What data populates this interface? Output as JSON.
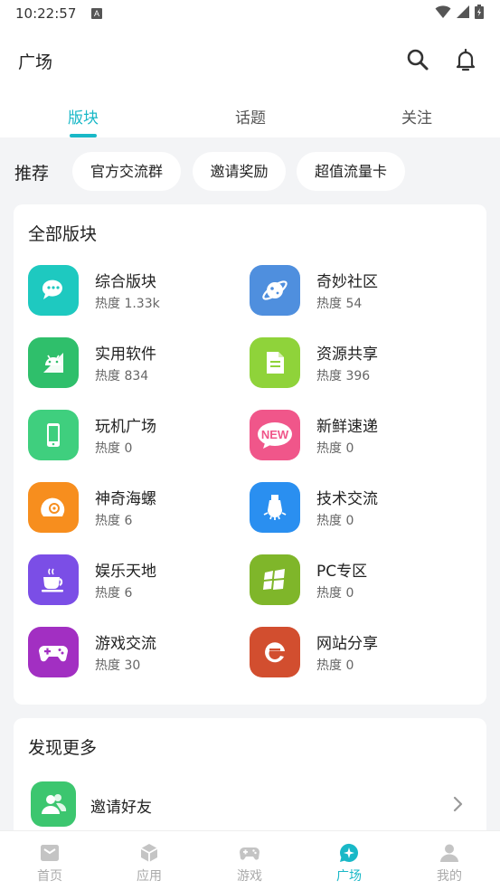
{
  "status_bar": {
    "time": "10:22:57",
    "notification_glyph": "A"
  },
  "header": {
    "title": "广场"
  },
  "tabs": [
    {
      "label": "版块",
      "active": true
    },
    {
      "label": "话题",
      "active": false
    },
    {
      "label": "关注",
      "active": false
    }
  ],
  "recommend": {
    "label": "推荐",
    "chips": [
      "官方交流群",
      "邀请奖励",
      "超值流量卡"
    ]
  },
  "boards": {
    "title": "全部版块",
    "items": [
      {
        "name": "综合版块",
        "heat": "热度 1.33k",
        "icon": "chat-bubbles-icon",
        "color": "#1ec9c0"
      },
      {
        "name": "奇妙社区",
        "heat": "热度 54",
        "icon": "planet-icon",
        "color": "#4f8fde"
      },
      {
        "name": "实用软件",
        "heat": "热度 834",
        "icon": "android-icon",
        "color": "#2fbf6b"
      },
      {
        "name": "资源共享",
        "heat": "热度 396",
        "icon": "document-icon",
        "color": "#8fd33a"
      },
      {
        "name": "玩机广场",
        "heat": "热度 0",
        "icon": "phone-icon",
        "color": "#3fcf7e"
      },
      {
        "name": "新鲜速递",
        "heat": "热度 0",
        "icon": "new-badge-icon",
        "color": "#f0568a"
      },
      {
        "name": "神奇海螺",
        "heat": "热度 6",
        "icon": "shell-icon",
        "color": "#f78e1e"
      },
      {
        "name": "技术交流",
        "heat": "热度 0",
        "icon": "lightbulb-icon",
        "color": "#2a8ff0"
      },
      {
        "name": "娱乐天地",
        "heat": "热度 6",
        "icon": "coffee-cup-icon",
        "color": "#7b4ee6"
      },
      {
        "name": "PC专区",
        "heat": "热度 0",
        "icon": "windows-icon",
        "color": "#7fb62a"
      },
      {
        "name": "游戏交流",
        "heat": "热度 30",
        "icon": "gamepad-icon",
        "color": "#a22fc2"
      },
      {
        "name": "网站分享",
        "heat": "热度 0",
        "icon": "browser-e-icon",
        "color": "#d24e2f"
      }
    ]
  },
  "discover": {
    "title": "发现更多",
    "items": [
      {
        "name": "邀请好友",
        "icon": "invite-friends-icon"
      }
    ]
  },
  "bottom_nav": [
    {
      "label": "首页",
      "icon": "home-icon",
      "active": false
    },
    {
      "label": "应用",
      "icon": "box-icon",
      "active": false
    },
    {
      "label": "游戏",
      "icon": "gamepad-icon",
      "active": false
    },
    {
      "label": "广场",
      "icon": "square-chat-icon",
      "active": true
    },
    {
      "label": "我的",
      "icon": "person-icon",
      "active": false
    }
  ],
  "colors": {
    "accent": "#19b8c7",
    "background": "#f3f4f6",
    "card": "#ffffff"
  }
}
